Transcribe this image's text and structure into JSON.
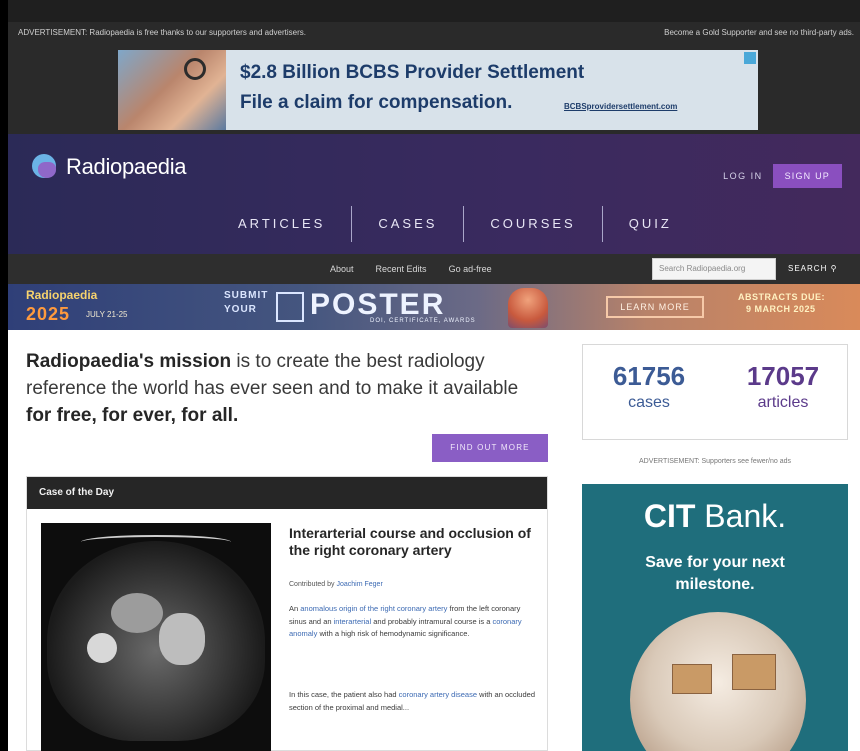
{
  "ad_strip": {
    "left_note": "ADVERTISEMENT: Radiopaedia is free thanks to our supporters and advertisers.",
    "right_note": "Become a Gold Supporter and see no third-party ads.",
    "banner_line1": "$2.8 Billion BCBS Provider Settlement",
    "banner_line2": "File a claim for compensation.",
    "banner_url": "BCBSprovidersettlement.com"
  },
  "header": {
    "logo_text": "Radiopaedia",
    "login": "LOG IN",
    "signup": "SIGN UP",
    "nav": [
      "ARTICLES",
      "CASES",
      "COURSES",
      "QUIZ"
    ]
  },
  "subnav": {
    "links": [
      "About",
      "Recent Edits",
      "Go ad-free"
    ],
    "search_placeholder": "Search Radiopaedia.org",
    "search_button": "SEARCH"
  },
  "promo": {
    "brand": "Radiopaedia",
    "year": "2025",
    "dates": "JULY 21-25",
    "submit_line1": "SUBMIT",
    "submit_line2": "YOUR",
    "poster": "POSTER",
    "cert": "DOI, CERTIFICATE, AWARDS",
    "learn_more": "LEARN MORE",
    "abstracts_line1": "ABSTRACTS DUE:",
    "abstracts_line2": "9 MARCH 2025"
  },
  "mission": {
    "brand": "Radiopaedia's mission",
    "text1": " is to create the best radiology reference the world has ever seen and to make it available ",
    "text2": "for free, for ever, for all.",
    "button": "FIND OUT MORE"
  },
  "stats": {
    "cases_count": "61756",
    "cases_label": "cases",
    "articles_count": "17057",
    "articles_label": "articles"
  },
  "side_ad": {
    "note": "ADVERTISEMENT: Supporters see fewer/no ads",
    "brand_bold": "CIT",
    "brand_rest": " Bank.",
    "tag1": "Save for your next",
    "tag2": "milestone."
  },
  "case_of_day": {
    "header": "Case of the Day",
    "title": "Interarterial course and occlusion of the right coronary artery",
    "contributed_prefix": "Contributed by ",
    "author": "Joachim Feger",
    "p1_a": "An ",
    "p1_link1": "anomalous origin of the right coronary artery",
    "p1_b": " from the left coronary sinus and an ",
    "p1_link2": "interarterial",
    "p1_c": " and probably intramural course is a ",
    "p1_link3": "coronary anomaly",
    "p1_d": " with a high risk of hemodynamic significance.",
    "p2_a": "In this case, the patient also had ",
    "p2_link": "coronary artery disease",
    "p2_b": " with an occluded section of the proximal and medial..."
  }
}
